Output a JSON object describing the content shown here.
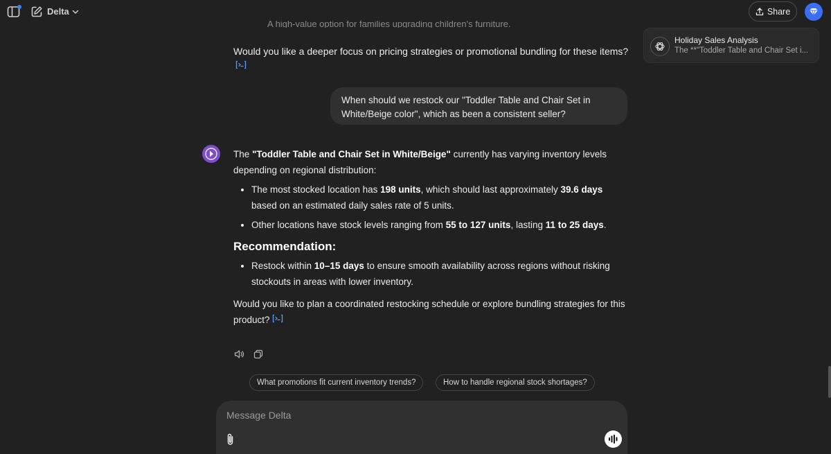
{
  "header": {
    "model_name": "Delta",
    "share_label": "Share",
    "icons": [
      "sidebar-toggle-icon",
      "new-chat-icon",
      "chevron-down-icon",
      "share-icon",
      "diamond-icon"
    ]
  },
  "notification": {
    "title": "Holiday Sales Analysis",
    "subtitle": "The **\"Toddler Table and Chair Set i..."
  },
  "conversation": {
    "previous_answer_clipped_line": "A high-value option for families upgrading children's furniture.",
    "previous_answer_question": "Would you like a deeper focus on pricing strategies or promotional bundling for these items?",
    "user_message": "When should we restock our \"Toddler Table and Chair Set in White/Beige color\", which as been a consistent seller?",
    "assistant": {
      "intro": {
        "pre": "The ",
        "bold": "\"Toddler Table and Chair Set in White/Beige\"",
        "post": " currently has varying inventory levels depending on regional distribution:"
      },
      "bullet1": {
        "t1": "The most stocked location has ",
        "b1": "198 units",
        "t2": ", which should last approximately ",
        "b2": "39.6 days",
        "t3": " based on an estimated daily sales rate of 5 units."
      },
      "bullet2": {
        "t1": "Other locations have stock levels ranging from ",
        "b1": "55 to 127 units",
        "t2": ", lasting ",
        "b2": "11 to 25 days",
        "t3": "."
      },
      "recommendation_heading": "Recommendation:",
      "recommendation": {
        "t1": "Restock within ",
        "b1": "10–15 days",
        "t2": " to ensure smooth availability across regions without risking stockouts in areas with lower inventory."
      },
      "closing": "Would you like to plan a coordinated restocking schedule or explore bundling strategies for this product?"
    }
  },
  "suggestions": [
    "What promotions fit current inventory trends?",
    "How to handle regional stock shortages?"
  ],
  "composer": {
    "placeholder": "Message Delta"
  },
  "colors": {
    "background": "#212121",
    "bubble": "#303030",
    "accent": "#3b6ef5",
    "citation": "#4a9eff",
    "assistant_avatar": "#7c4dcc"
  }
}
